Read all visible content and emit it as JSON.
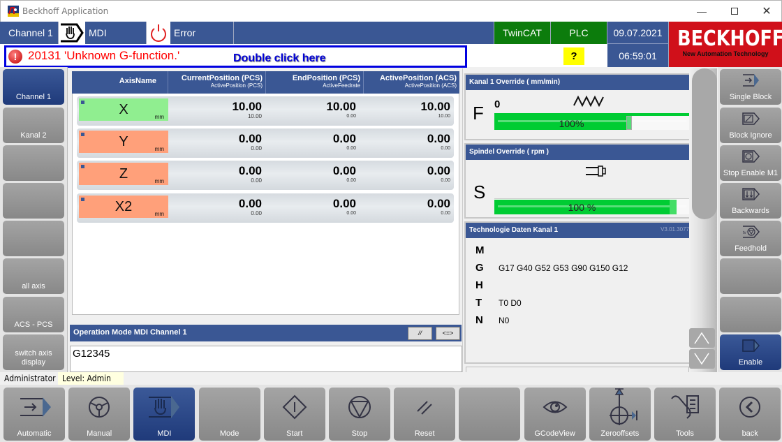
{
  "window": {
    "title": "Beckhoff Application",
    "minimize_icon": "minimize-icon",
    "maximize_icon": "maximize-icon",
    "close_icon": "close-icon"
  },
  "header": {
    "channel": "Channel  1",
    "mode_icon": "hand-icon",
    "mode": "MDI",
    "state_icon": "power-icon",
    "state": "Error",
    "twincat": "TwinCAT",
    "plc": "PLC",
    "date": "09.07.2021",
    "time": "06:59:01",
    "help": "?",
    "logo": "BECKHOFF",
    "logo_tagline": "New Automation Technology",
    "colors": {
      "header_blue": "#3a5794",
      "status_green": "#0c7c0c",
      "logo_red": "#d0101a",
      "help_yellow": "#ffff00"
    }
  },
  "error": {
    "icon": "error-icon",
    "message": "20131 'Unknown G-function.'",
    "hint": "Double click here",
    "color": "#ff0000"
  },
  "left_sidebar": [
    {
      "label": "Channel 1",
      "active": true
    },
    {
      "label": "Kanal 2",
      "active": false
    },
    {
      "label": "",
      "active": false
    },
    {
      "label": "",
      "active": false
    },
    {
      "label": "",
      "active": false
    },
    {
      "label": "all axis",
      "active": false
    },
    {
      "label": "ACS - PCS",
      "active": false
    },
    {
      "label": "switch axis display",
      "active": false
    }
  ],
  "axis_table": {
    "columns": [
      {
        "main": "AxisName",
        "sub": ""
      },
      {
        "main": "CurrentPosition (PCS)",
        "sub": "ActivePosition (PCS)"
      },
      {
        "main": "EndPosition (PCS)",
        "sub": "ActiveFeedrate"
      },
      {
        "main": "ActivePosition (ACS)",
        "sub": "ActivePosition (ACS)"
      }
    ],
    "rows": [
      {
        "name": "X",
        "unit": "mm",
        "state": "ok",
        "current": "10.00",
        "current_sub": "10.00",
        "end": "10.00",
        "end_sub": "0.00",
        "acs": "10.00",
        "acs_sub": "10.00"
      },
      {
        "name": "Y",
        "unit": "mm",
        "state": "warn",
        "current": "0.00",
        "current_sub": "0.00",
        "end": "0.00",
        "end_sub": "0.00",
        "acs": "0.00",
        "acs_sub": "0.00"
      },
      {
        "name": "Z",
        "unit": "mm",
        "state": "warn",
        "current": "0.00",
        "current_sub": "0.00",
        "end": "0.00",
        "end_sub": "0.00",
        "acs": "0.00",
        "acs_sub": "0.00"
      },
      {
        "name": "X2",
        "unit": "mm",
        "state": "warn",
        "current": "0.00",
        "current_sub": "0.00",
        "end": "0.00",
        "end_sub": "0.00",
        "acs": "0.00",
        "acs_sub": "0.00"
      }
    ],
    "state_colors": {
      "ok": "#90ee90",
      "warn": "#ffa07a"
    }
  },
  "mdi": {
    "title": "Operation Mode MDI Channel 1",
    "btn_skip": "//",
    "btn_swap": "<=>",
    "input_value": "G12345"
  },
  "feed_override": {
    "title": "Kanal 1 Override  ( mm/min)",
    "letter": "F",
    "value": "0",
    "icon": "feed-zigzag-icon",
    "percent_label": "100%",
    "fill_fraction": 0.7
  },
  "spindle_override": {
    "title": "Spindel Override   ( rpm     )",
    "letter": "S",
    "icon": "spindle-icon",
    "percent_label": "100 %",
    "fill_fraction": 0.93
  },
  "technology": {
    "title": "Technologie Daten Kanal 1",
    "version": "V3.01.3077",
    "rows": [
      {
        "letter": "M",
        "value": ""
      },
      {
        "letter": "G",
        "value": "G17 G40 G52 G53 G90 G150 G12"
      },
      {
        "letter": "H",
        "value": ""
      },
      {
        "letter": "T",
        "value": "T0   D0"
      },
      {
        "letter": "N",
        "value": "N0"
      }
    ]
  },
  "right_sidebar": [
    {
      "label": "Single Block",
      "icon": "single-block-icon",
      "active": false
    },
    {
      "label": "Block Ignore",
      "icon": "block-ignore-icon",
      "active": false
    },
    {
      "label": "Stop Enable M1",
      "icon": "stop-enable-icon",
      "active": false
    },
    {
      "label": "Backwards",
      "icon": "backwards-icon",
      "active": false
    },
    {
      "label": "Feedhold",
      "icon": "feedhold-icon",
      "active": false
    },
    {
      "label": "",
      "icon": "",
      "active": false
    },
    {
      "label": "",
      "icon": "",
      "active": false
    },
    {
      "label": "Enable",
      "icon": "enable-icon",
      "active": true
    }
  ],
  "status": {
    "user": "Administrator",
    "level": "Level: Admin"
  },
  "bottom_bar": [
    {
      "label": "Automatic",
      "icon": "automatic-icon",
      "active": false
    },
    {
      "label": "Manual",
      "icon": "steering-wheel-icon",
      "active": false
    },
    {
      "label": "MDI",
      "icon": "hand-icon",
      "active": true
    },
    {
      "label": "Mode",
      "icon": "",
      "active": false
    },
    {
      "label": "Start",
      "icon": "start-icon",
      "active": false
    },
    {
      "label": "Stop",
      "icon": "stop-icon",
      "active": false
    },
    {
      "label": "Reset",
      "icon": "reset-icon",
      "active": false
    },
    {
      "label": "",
      "icon": "",
      "active": false
    },
    {
      "label": "GCodeView",
      "icon": "eye-icon",
      "active": false
    },
    {
      "label": "Zerooffsets",
      "icon": "zero-offset-icon",
      "active": false
    },
    {
      "label": "Tools",
      "icon": "tools-icon",
      "active": false
    },
    {
      "label": "back",
      "icon": "back-icon",
      "active": false
    }
  ]
}
